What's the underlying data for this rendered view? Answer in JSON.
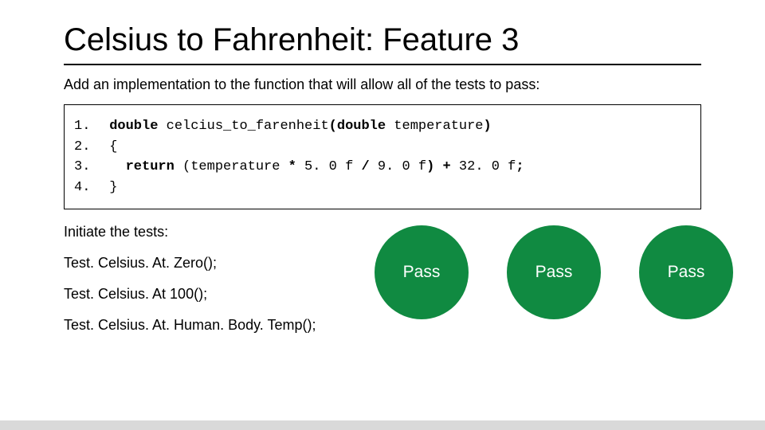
{
  "title": "Celsius to Fahrenheit: Feature 3",
  "subtitle": "Add an implementation to the function that will allow all of the tests to pass:",
  "code": {
    "lines": [
      [
        {
          "t": "1.",
          "cls": "ln"
        },
        {
          "t": " "
        },
        {
          "t": "double",
          "cls": "kw"
        },
        {
          "t": " celcius_to_farenheit"
        },
        {
          "t": "(double",
          "cls": "kw"
        },
        {
          "t": " temperature"
        },
        {
          "t": ")",
          "cls": "kw"
        }
      ],
      [
        {
          "t": "2.",
          "cls": "ln"
        },
        {
          "t": " {"
        }
      ],
      [
        {
          "t": "3.",
          "cls": "ln"
        },
        {
          "t": "   "
        },
        {
          "t": "return",
          "cls": "kw"
        },
        {
          "t": " (temperature "
        },
        {
          "t": "*",
          "cls": "kw"
        },
        {
          "t": " 5. 0 f "
        },
        {
          "t": "/",
          "cls": "kw"
        },
        {
          "t": " 9. 0 f"
        },
        {
          "t": ")",
          "cls": "kw"
        },
        {
          "t": " "
        },
        {
          "t": "+",
          "cls": "kw"
        },
        {
          "t": " 32. 0 f"
        },
        {
          "t": ";",
          "cls": "kw"
        }
      ],
      [
        {
          "t": "4.",
          "cls": "ln"
        },
        {
          "t": " }"
        }
      ]
    ]
  },
  "tests_label": "Initiate the tests:",
  "tests": [
    "Test. Celsius. At. Zero();",
    "Test. Celsius. At 100();",
    "Test. Celsius. At. Human. Body. Temp();"
  ],
  "results": [
    "Pass",
    "Pass",
    "Pass"
  ],
  "colors": {
    "pass": "#108a41"
  }
}
